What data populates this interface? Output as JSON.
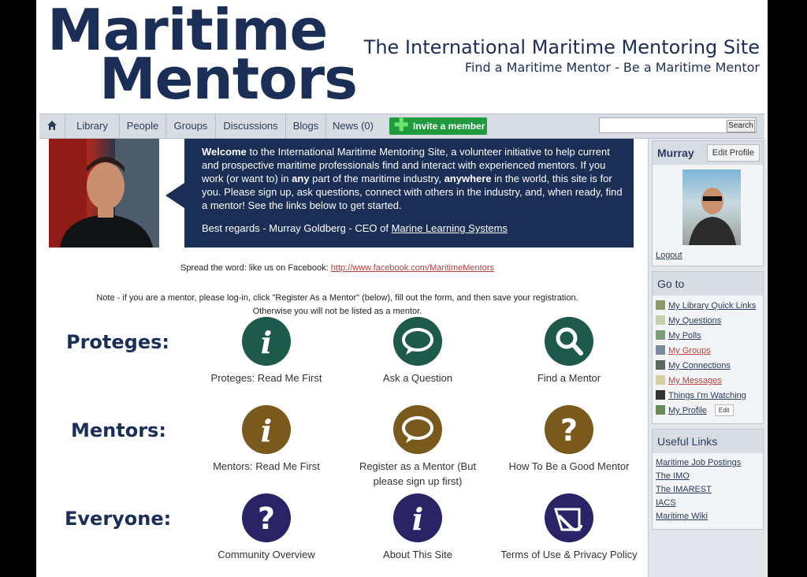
{
  "logo": {
    "line1": "Maritime",
    "line2": "Mentors"
  },
  "tagline": {
    "title": "The International Maritime Mentoring Site",
    "subtitle": "Find a Maritime Mentor - Be a Maritime Mentor"
  },
  "nav": {
    "items": [
      "Library",
      "People",
      "Groups",
      "Discussions",
      "Blogs",
      "News (0)"
    ],
    "invite": "Invite a member",
    "search_button": "Search",
    "search_value": ""
  },
  "welcome": {
    "p1_bold": "Welcome",
    "p1_a": " to the International Maritime Mentoring Site, a volunteer initiative to help current and prospective maritime professionals find and interact with experienced mentors. If you work (or want to) in ",
    "p1_any": "any",
    "p1_b": " part of the maritime industry, ",
    "p1_anywhere": "anywhere",
    "p1_c": " in the world, this site is for you. Please sign up, ask questions, connect with others in the industry, and, when ready, find a mentor! See the links below to get started.",
    "sig_text": "Best regards - Murray Goldberg - CEO of ",
    "sig_link": "Marine Learning Systems"
  },
  "spread": {
    "text": "Spread the word: like us on Facebook: ",
    "link": "http://www.facebook.com/MaritimeMentors"
  },
  "note": {
    "line1": "Note - if you are a mentor, please log-in, click \"Register As a Mentor\" (below), fill out the form, and then save your registration.",
    "line2": "Otherwise you will not be listed as a mentor."
  },
  "rows": [
    {
      "label": "Proteges:",
      "tiles": [
        {
          "caption": "Proteges: Read Me First",
          "icon": "info-icon"
        },
        {
          "caption": "Ask a Question",
          "icon": "speech-bubble-icon"
        },
        {
          "caption": "Find a Mentor",
          "icon": "magnifier-icon"
        }
      ]
    },
    {
      "label": "Mentors:",
      "tiles": [
        {
          "caption": "Mentors: Read Me First",
          "icon": "info-icon"
        },
        {
          "caption": "Register as a Mentor (But please sign up first)",
          "icon": "speech-bubble-icon"
        },
        {
          "caption": "How To Be a Good Mentor",
          "icon": "question-icon"
        }
      ]
    },
    {
      "label": "Everyone:",
      "tiles": [
        {
          "caption": "Community Overview",
          "icon": "question-icon"
        },
        {
          "caption": "About This Site",
          "icon": "info-icon"
        },
        {
          "caption": "Terms of Use & Privacy Policy",
          "icon": "paperclip-icon"
        }
      ]
    }
  ],
  "colors": {
    "navy": "#1b2e56",
    "teal": "#1d5a4b",
    "brown": "#7a5a1c",
    "purple": "#2a2466",
    "invite_green": "#1f9a3c"
  },
  "sidebar": {
    "user": {
      "name": "Murray",
      "edit_profile": "Edit Profile",
      "logout": "Logout"
    },
    "goto": {
      "title": "Go to",
      "links": [
        {
          "label": "My Library Quick Links",
          "icon": "library-icon"
        },
        {
          "label": "My Questions",
          "icon": "question-doc-icon"
        },
        {
          "label": "My Polls",
          "icon": "poll-icon"
        },
        {
          "label": "My Groups",
          "icon": "group-icon"
        },
        {
          "label": "My Connections",
          "icon": "connections-icon"
        },
        {
          "label": "My Messages",
          "icon": "envelope-icon"
        },
        {
          "label": "Things I'm Watching",
          "icon": "binoculars-icon"
        },
        {
          "label": "My Profile",
          "icon": "profile-icon"
        }
      ],
      "edit": "Edit"
    },
    "useful": {
      "title": "Useful Links",
      "links": [
        "Maritime Job Postings",
        "The IMO",
        "The IMAREST",
        "IACS",
        "Maritime Wiki"
      ]
    }
  }
}
